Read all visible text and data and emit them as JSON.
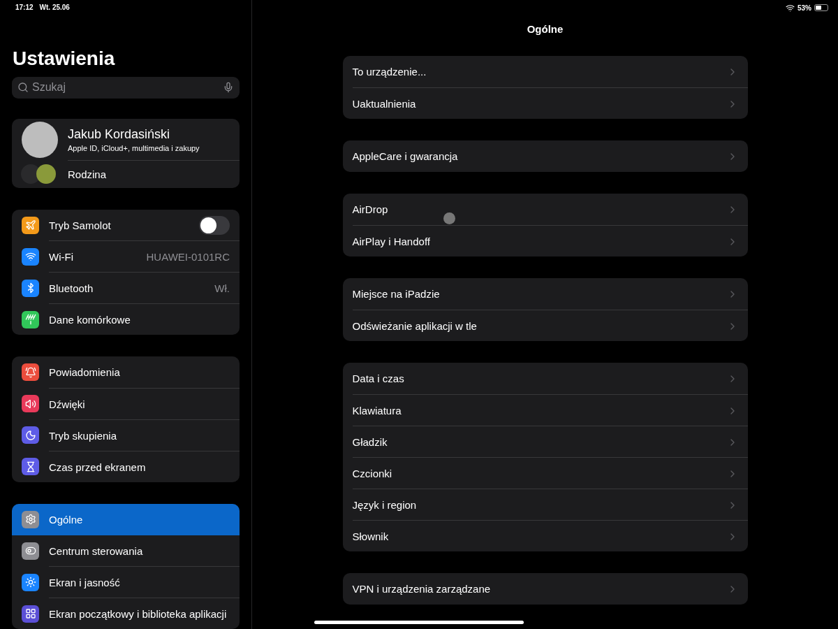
{
  "status_bar": {
    "time": "17:12",
    "date": "Wt. 25.06",
    "battery": "53%"
  },
  "sidebar": {
    "title": "Ustawienia",
    "search": {
      "placeholder": "Szukaj"
    },
    "profile": {
      "name": "Jakub Kordasiński",
      "subtitle": "Apple ID, iCloud+, multimedia i zakupy",
      "family": "Rodzina"
    },
    "groups": [
      [
        {
          "label": "Tryb Samolot",
          "kind": "toggle",
          "on": false,
          "color": "#f49a1a",
          "selected": false
        },
        {
          "label": "Wi-Fi",
          "kind": "value",
          "value": "HUAWEI-0101RC",
          "color": "#1a84ff",
          "selected": false
        },
        {
          "label": "Bluetooth",
          "kind": "value",
          "value": "Wł.",
          "color": "#1a84ff",
          "selected": false
        },
        {
          "label": "Dane komórkowe",
          "kind": "plain",
          "color": "#31c75a",
          "selected": false
        }
      ],
      [
        {
          "label": "Powiadomienia",
          "kind": "plain",
          "color": "#eb4d3d",
          "selected": false
        },
        {
          "label": "Dźwięki",
          "kind": "plain",
          "color": "#e93a5a",
          "selected": false
        },
        {
          "label": "Tryb skupienia",
          "kind": "plain",
          "color": "#5e5ce6",
          "selected": false
        },
        {
          "label": "Czas przed ekranem",
          "kind": "plain",
          "color": "#5e5ce6",
          "selected": false
        }
      ],
      [
        {
          "label": "Ogólne",
          "kind": "plain",
          "color": "#8e8e93",
          "selected": true
        },
        {
          "label": "Centrum sterowania",
          "kind": "plain",
          "color": "#8e8e93",
          "selected": false
        },
        {
          "label": "Ekran i jasność",
          "kind": "plain",
          "color": "#1a84ff",
          "selected": false
        },
        {
          "label": "Ekran początkowy i biblioteka aplikacji",
          "kind": "plain",
          "color": "#5b4fd6",
          "selected": false
        }
      ]
    ]
  },
  "detail": {
    "title": "Ogólne",
    "groups": [
      [
        "To urządzenie...",
        "Uaktualnienia"
      ],
      [
        "AppleCare i gwarancja"
      ],
      [
        "AirDrop",
        "AirPlay i Handoff"
      ],
      [
        "Miejsce na iPadzie",
        "Odświeżanie aplikacji w tle"
      ],
      [
        "Data i czas",
        "Klawiatura",
        "Gładzik",
        "Czcionki",
        "Język i region",
        "Słownik"
      ],
      [
        "VPN i urządzenia zarządzane"
      ]
    ]
  }
}
